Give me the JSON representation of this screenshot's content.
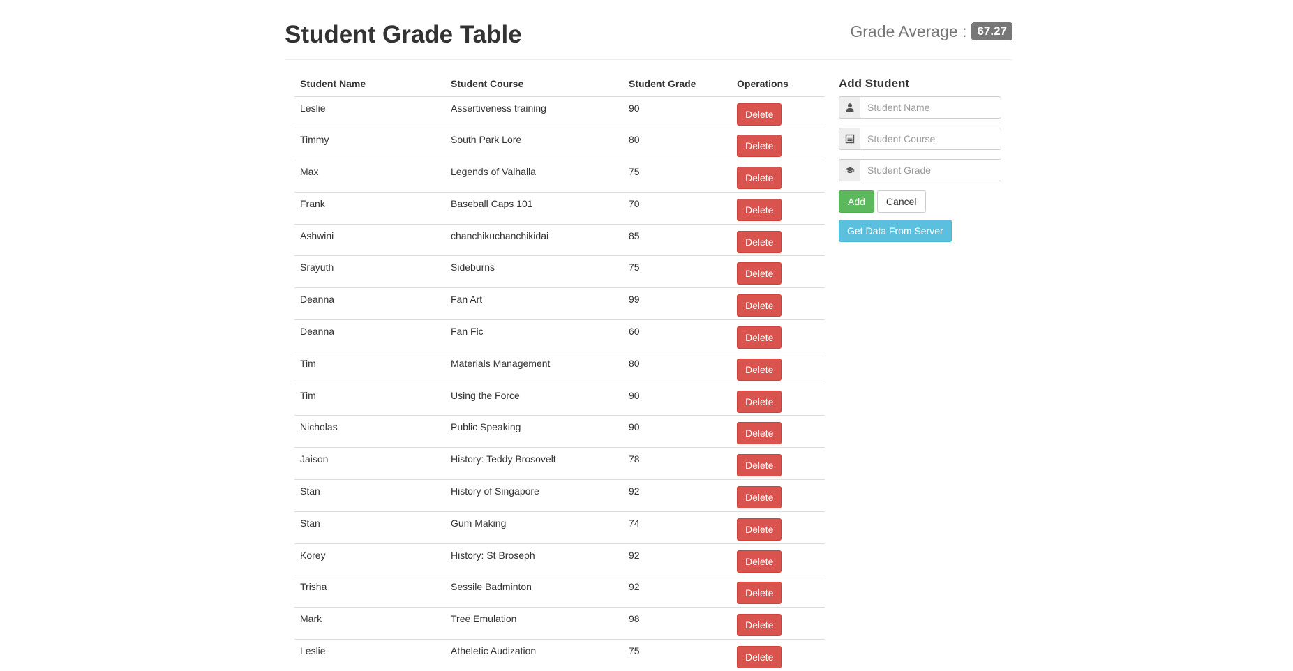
{
  "header": {
    "title": "Student Grade Table",
    "average_label": "Grade Average :",
    "average_value": "67.27"
  },
  "table": {
    "columns": [
      "Student Name",
      "Student Course",
      "Student Grade",
      "Operations"
    ],
    "delete_label": "Delete",
    "rows": [
      {
        "name": "Leslie",
        "course": "Assertiveness training",
        "grade": "90"
      },
      {
        "name": "Timmy",
        "course": "South Park Lore",
        "grade": "80"
      },
      {
        "name": "Max",
        "course": "Legends of Valhalla",
        "grade": "75"
      },
      {
        "name": "Frank",
        "course": "Baseball Caps 101",
        "grade": "70"
      },
      {
        "name": "Ashwini",
        "course": "chanchikuchanchikidai",
        "grade": "85"
      },
      {
        "name": "Srayuth",
        "course": "Sideburns",
        "grade": "75"
      },
      {
        "name": "Deanna",
        "course": "Fan Art",
        "grade": "99"
      },
      {
        "name": "Deanna",
        "course": "Fan Fic",
        "grade": "60"
      },
      {
        "name": "Tim",
        "course": "Materials Management",
        "grade": "80"
      },
      {
        "name": "Tim",
        "course": "Using the Force",
        "grade": "90"
      },
      {
        "name": "Nicholas",
        "course": "Public Speaking",
        "grade": "90"
      },
      {
        "name": "Jaison",
        "course": "History: Teddy Brosovelt",
        "grade": "78"
      },
      {
        "name": "Stan",
        "course": "History of Singapore",
        "grade": "92"
      },
      {
        "name": "Stan",
        "course": "Gum Making",
        "grade": "74"
      },
      {
        "name": "Korey",
        "course": "History: St Broseph",
        "grade": "92"
      },
      {
        "name": "Trisha",
        "course": "Sessile Badminton",
        "grade": "92"
      },
      {
        "name": "Mark",
        "course": "Tree Emulation",
        "grade": "98"
      },
      {
        "name": "Leslie",
        "course": "Atheletic Audization",
        "grade": "75"
      }
    ]
  },
  "add_form": {
    "title": "Add Student",
    "name_placeholder": "Student Name",
    "course_placeholder": "Student Course",
    "grade_placeholder": "Student Grade",
    "add_label": "Add",
    "cancel_label": "Cancel",
    "server_label": "Get Data From Server",
    "icons": {
      "name": "user-icon",
      "course": "list-alt-icon",
      "grade": "education-icon"
    }
  },
  "colors": {
    "danger": "#d9534f",
    "success": "#5cb85c",
    "info": "#5bc0de",
    "badge": "#777777"
  }
}
